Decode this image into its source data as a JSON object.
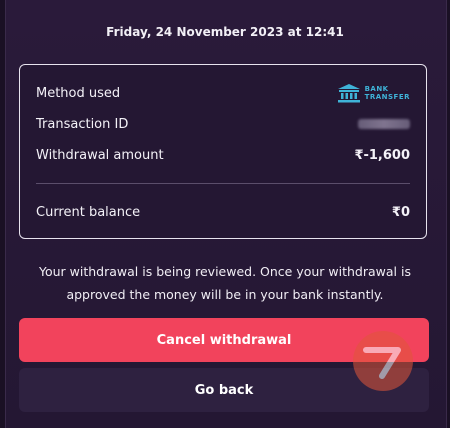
{
  "header": {
    "datetime": "Friday, 24 November 2023 at 12:41"
  },
  "details": {
    "method_label": "Method used",
    "method_logo_line1": "BANK",
    "method_logo_line2": "TRANSFER",
    "transaction_id_label": "Transaction ID",
    "withdrawal_amount_label": "Withdrawal amount",
    "withdrawal_amount_value": "₹-1,600",
    "current_balance_label": "Current balance",
    "current_balance_value": "₹0"
  },
  "message": {
    "line1": "Your withdrawal is being reviewed. Once your withdrawal is",
    "line2": "approved the money will be in your bank instantly."
  },
  "actions": {
    "cancel_label": "Cancel withdrawal",
    "back_label": "Go back"
  },
  "colors": {
    "background": "#241733",
    "accent": "#f2435c",
    "secondary_button": "#2e2140",
    "bank_logo": "#3fb3d8"
  },
  "icons": {
    "bank": "bank-building-icon",
    "watermark": "watermark-logo"
  }
}
